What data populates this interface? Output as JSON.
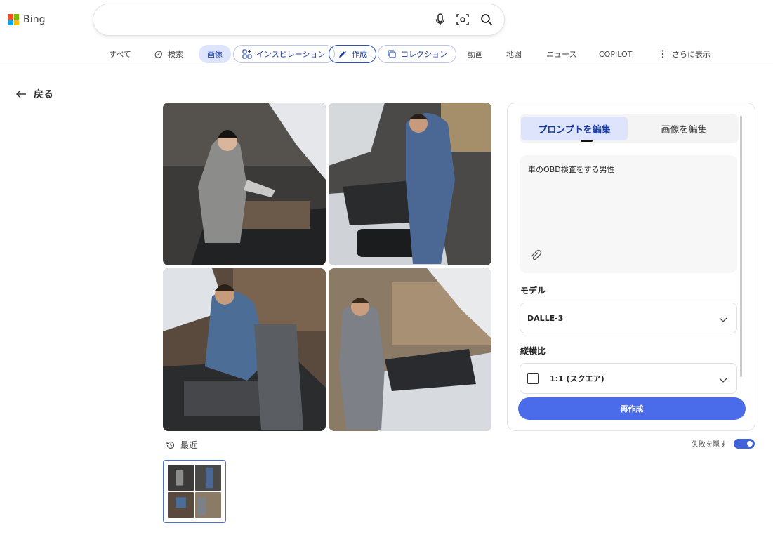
{
  "brand": {
    "logo_text": "Bing",
    "logo_colors": [
      "#f25022",
      "#7fba00",
      "#00a4ef",
      "#ffb900"
    ]
  },
  "search": {
    "value": "",
    "placeholder": ""
  },
  "tabs": [
    {
      "label": "すべて"
    },
    {
      "label": "検索"
    },
    {
      "label": "画像"
    },
    {
      "label": "インスピレーション"
    },
    {
      "label": "作成"
    },
    {
      "label": "コレクション"
    },
    {
      "label": "動画"
    },
    {
      "label": "地図"
    },
    {
      "label": "ニュース"
    },
    {
      "label": "COPILOT"
    },
    {
      "label": "さらに表示"
    }
  ],
  "back": {
    "label": "戻る"
  },
  "recent": {
    "label": "最近"
  },
  "hide_failures": {
    "label": "失敗を隠す",
    "enabled": true
  },
  "panel": {
    "tab_edit_prompt": "プロンプトを編集",
    "tab_edit_image": "画像を編集",
    "prompt_text": "車のOBD検査をする男性",
    "model_label": "モデル",
    "model_value": "DALLE-3",
    "aspect_label": "縦横比",
    "aspect_value": "1:1 (スクエア)",
    "regenerate": "再作成"
  },
  "colors": {
    "accent": "#4a6cea",
    "active_tab_bg": "#dde4fb",
    "active_text": "#1a3c9e"
  }
}
